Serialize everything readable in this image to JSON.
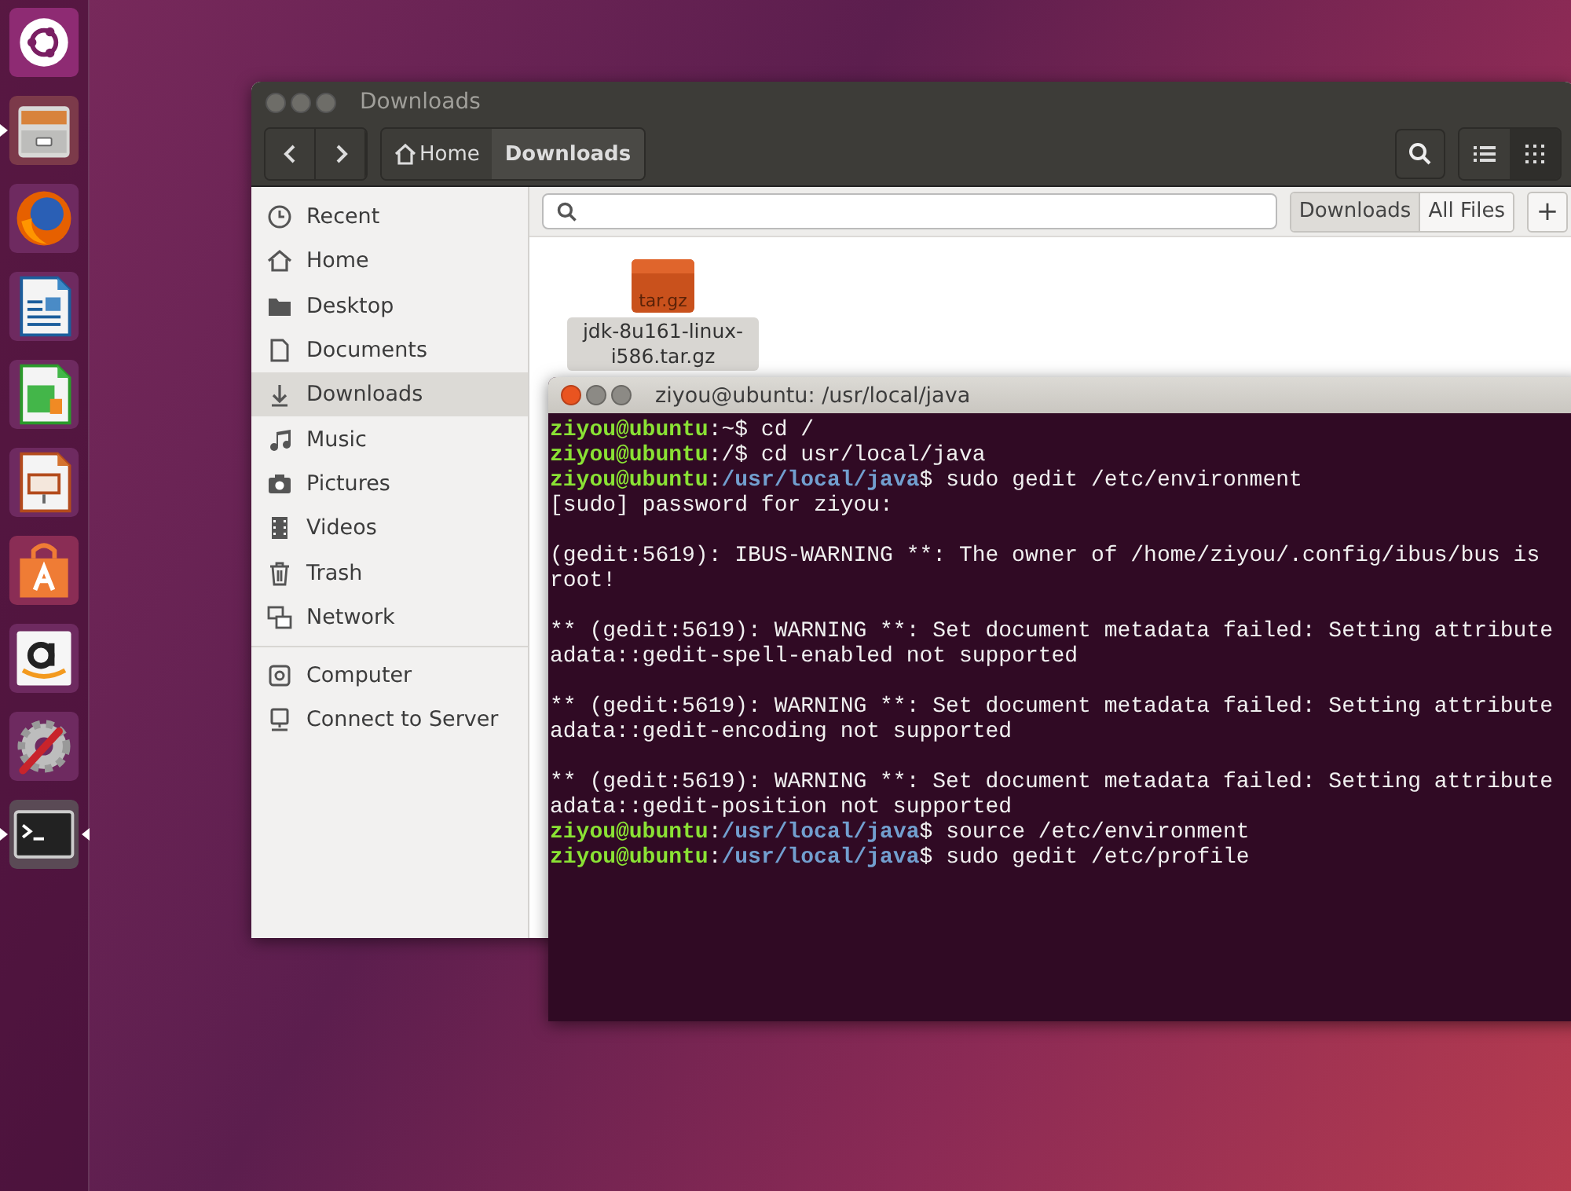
{
  "launcher": [
    {
      "kind": "ubuntu",
      "running": false,
      "focused": false
    },
    {
      "kind": "files",
      "running": true,
      "focused": false
    },
    {
      "kind": "firefox",
      "running": false,
      "focused": false
    },
    {
      "kind": "writer",
      "running": false,
      "focused": false
    },
    {
      "kind": "calc",
      "running": false,
      "focused": false
    },
    {
      "kind": "impress",
      "running": false,
      "focused": false
    },
    {
      "kind": "store",
      "running": false,
      "focused": false
    },
    {
      "kind": "amazon",
      "running": false,
      "focused": false
    },
    {
      "kind": "settings",
      "running": false,
      "focused": false
    },
    {
      "kind": "terminal",
      "running": true,
      "focused": true
    }
  ],
  "files": {
    "title": "Downloads",
    "path": [
      {
        "label": "Home",
        "kind": "home",
        "selected": false
      },
      {
        "label": "Downloads",
        "kind": "folder",
        "selected": true
      }
    ],
    "views": [
      {
        "kind": "list",
        "selected": false
      },
      {
        "kind": "grid",
        "selected": true
      }
    ],
    "sidebar_groups": [
      {
        "items": [
          {
            "label": "Recent",
            "kind": "recent",
            "selected": false
          },
          {
            "label": "Home",
            "kind": "home",
            "selected": false
          },
          {
            "label": "Desktop",
            "kind": "folder",
            "selected": false
          },
          {
            "label": "Documents",
            "kind": "document",
            "selected": false
          },
          {
            "label": "Downloads",
            "kind": "download",
            "selected": true
          },
          {
            "label": "Music",
            "kind": "music",
            "selected": false
          },
          {
            "label": "Pictures",
            "kind": "camera",
            "selected": false
          },
          {
            "label": "Videos",
            "kind": "film",
            "selected": false
          },
          {
            "label": "Trash",
            "kind": "trash",
            "selected": false
          },
          {
            "label": "Network",
            "kind": "network",
            "selected": false
          }
        ]
      },
      {
        "items": [
          {
            "label": "Computer",
            "kind": "drive",
            "selected": false
          },
          {
            "label": "Connect to Server",
            "kind": "server",
            "selected": false
          }
        ]
      }
    ],
    "scopes": [
      {
        "label": "Downloads",
        "selected": true
      },
      {
        "label": "All Files",
        "selected": false
      }
    ],
    "add_button": "+",
    "file": {
      "badge": "tar.gz",
      "name": "jdk-8u161-linux-i586.tar.gz",
      "selected": true
    }
  },
  "terminal": {
    "title": "ziyou@ubuntu: /usr/local/java",
    "blocks": [
      {
        "lines": [
          {
            "segments": [
              {
                "kind": "user",
                "text": "ziyou@ubuntu"
              },
              {
                "kind": "plain",
                "text": ":~$ cd /"
              }
            ]
          },
          {
            "segments": [
              {
                "kind": "user",
                "text": "ziyou@ubuntu"
              },
              {
                "kind": "plain",
                "text": ":/$ cd usr/local/java"
              }
            ]
          },
          {
            "segments": [
              {
                "kind": "user",
                "text": "ziyou@ubuntu"
              },
              {
                "kind": "plain",
                "text": ":"
              },
              {
                "kind": "path",
                "text": "/usr/local/java"
              },
              {
                "kind": "plain",
                "text": "$ sudo gedit /etc/environment"
              }
            ]
          },
          {
            "segments": [
              {
                "kind": "plain",
                "text": "[sudo] password for ziyou:"
              }
            ]
          }
        ]
      },
      {
        "lines": [
          {
            "segments": [
              {
                "kind": "plain",
                "text": "(gedit:5619): IBUS-WARNING **: The owner of /home/ziyou/.config/ibus/bus is"
              }
            ]
          },
          {
            "segments": [
              {
                "kind": "plain",
                "text": "root!"
              }
            ]
          }
        ]
      },
      {
        "lines": [
          {
            "segments": [
              {
                "kind": "plain",
                "text": "** (gedit:5619): WARNING **: Set document metadata failed: Setting attribute"
              }
            ]
          },
          {
            "segments": [
              {
                "kind": "plain",
                "text": "adata::gedit-spell-enabled not supported"
              }
            ]
          }
        ]
      },
      {
        "lines": [
          {
            "segments": [
              {
                "kind": "plain",
                "text": "** (gedit:5619): WARNING **: Set document metadata failed: Setting attribute"
              }
            ]
          },
          {
            "segments": [
              {
                "kind": "plain",
                "text": "adata::gedit-encoding not supported"
              }
            ]
          }
        ]
      },
      {
        "lines": [
          {
            "segments": [
              {
                "kind": "plain",
                "text": "** (gedit:5619): WARNING **: Set document metadata failed: Setting attribute"
              }
            ]
          },
          {
            "segments": [
              {
                "kind": "plain",
                "text": "adata::gedit-position not supported"
              }
            ]
          },
          {
            "segments": [
              {
                "kind": "user",
                "text": "ziyou@ubuntu"
              },
              {
                "kind": "plain",
                "text": ":"
              },
              {
                "kind": "path",
                "text": "/usr/local/java"
              },
              {
                "kind": "plain",
                "text": "$ source /etc/environment"
              }
            ]
          },
          {
            "segments": [
              {
                "kind": "user",
                "text": "ziyou@ubuntu"
              },
              {
                "kind": "plain",
                "text": ":"
              },
              {
                "kind": "path",
                "text": "/usr/local/java"
              },
              {
                "kind": "plain",
                "text": "$ sudo gedit /etc/profile"
              }
            ]
          }
        ]
      }
    ]
  }
}
